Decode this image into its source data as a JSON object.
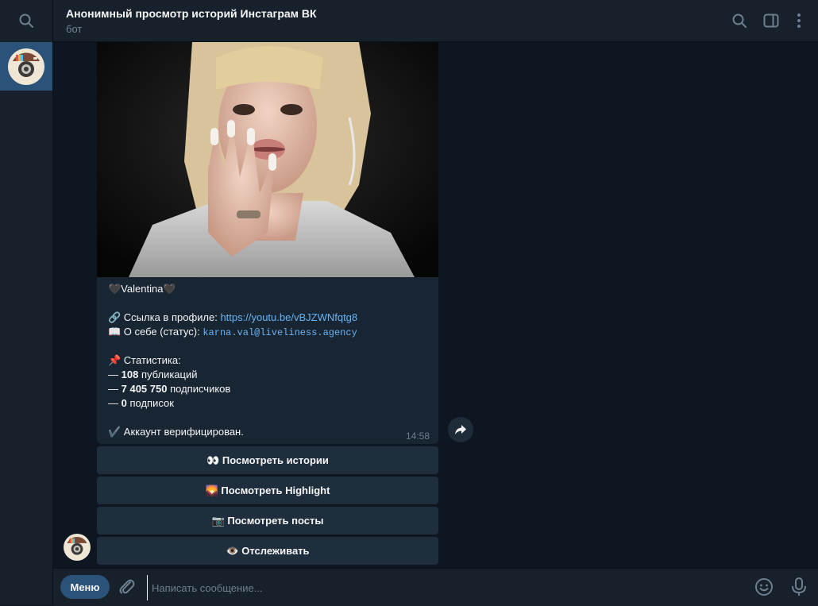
{
  "header": {
    "title": "Анонимный просмотр историй Инстаграм ВК",
    "subtitle": "бот"
  },
  "message": {
    "name_line": "🖤Valentina🖤",
    "link_label": "🔗 Ссылка в профиле: ",
    "link_url": "https://youtu.be/vBJZWNfqtg8",
    "about_label": "📖 О себе (статус): ",
    "about_value": "karna.val@liveliness.agency",
    "stats_label": "📌 Статистика:",
    "posts_count": "108",
    "posts_suffix": " публикаций",
    "followers_count": "7 405 750",
    "followers_suffix": " подписчиков",
    "following_count": "0",
    "following_suffix": " подписок",
    "dash": "— ",
    "verified": "✔️ Аккаунт верифицирован.",
    "time": "14:58"
  },
  "keyboard": [
    {
      "label": "👀 Посмотреть истории"
    },
    {
      "label": "🌄 Посмотреть Highlight"
    },
    {
      "label": "📷 Посмотреть посты"
    },
    {
      "label": "👁️ Отслеживать"
    }
  ],
  "composer": {
    "menu_label": "Меню",
    "placeholder": "Написать сообщение..."
  },
  "colors": {
    "background": "#0e1621",
    "panel": "#17212b",
    "accent": "#2b5278",
    "link": "#6ab3f3"
  }
}
